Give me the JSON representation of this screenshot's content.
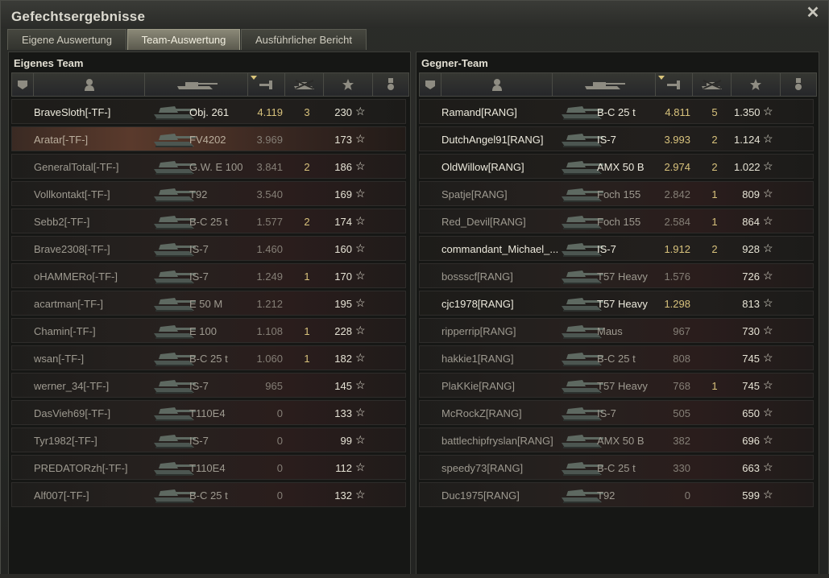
{
  "window": {
    "title": "Gefechtsergebnisse"
  },
  "tabs": [
    {
      "label": "Eigene Auswertung"
    },
    {
      "label": "Team-Auswertung"
    },
    {
      "label": "Ausführlicher Bericht"
    }
  ],
  "active_tab": 1,
  "left": {
    "title": "Eigenes Team",
    "rows": [
      {
        "name": "BraveSloth[-TF-]",
        "tank": "Obj. 261",
        "xp": "4.119",
        "kills": "3",
        "points": "230",
        "style": "hl",
        "xp_style": "gold"
      },
      {
        "name": "Aratar[-TF-]",
        "tank": "FV4202",
        "xp": "3.969",
        "kills": "",
        "points": "173",
        "style": "self",
        "xp_style": "gray"
      },
      {
        "name": "GeneralTotal[-TF-]",
        "tank": "G.W. E 100",
        "xp": "3.841",
        "kills": "2",
        "points": "186",
        "style": "dim",
        "xp_style": "gray"
      },
      {
        "name": "Vollkontakt[-TF-]",
        "tank": "T92",
        "xp": "3.540",
        "kills": "",
        "points": "169",
        "style": "dim",
        "xp_style": "gray"
      },
      {
        "name": "Sebb2[-TF-]",
        "tank": "B-C 25 t",
        "xp": "1.577",
        "kills": "2",
        "points": "174",
        "style": "dim",
        "xp_style": "gray"
      },
      {
        "name": "Brave2308[-TF-]",
        "tank": "IS-7",
        "xp": "1.460",
        "kills": "",
        "points": "160",
        "style": "dim",
        "xp_style": "gray"
      },
      {
        "name": "oHAMMERo[-TF-]",
        "tank": "IS-7",
        "xp": "1.249",
        "kills": "1",
        "points": "170",
        "style": "dim",
        "xp_style": "gray"
      },
      {
        "name": "acartman[-TF-]",
        "tank": "E 50 M",
        "xp": "1.212",
        "kills": "",
        "points": "195",
        "style": "dim",
        "xp_style": "gray"
      },
      {
        "name": "Chamin[-TF-]",
        "tank": "E 100",
        "xp": "1.108",
        "kills": "1",
        "points": "228",
        "style": "dim",
        "xp_style": "gray"
      },
      {
        "name": "wsan[-TF-]",
        "tank": "B-C 25 t",
        "xp": "1.060",
        "kills": "1",
        "points": "182",
        "style": "dim",
        "xp_style": "gray"
      },
      {
        "name": "werner_34[-TF-]",
        "tank": "IS-7",
        "xp": "965",
        "kills": "",
        "points": "145",
        "style": "dim",
        "xp_style": "gray"
      },
      {
        "name": "DasVieh69[-TF-]",
        "tank": "T110E4",
        "xp": "0",
        "kills": "",
        "points": "133",
        "style": "dim",
        "xp_style": "gray"
      },
      {
        "name": "Tyr1982[-TF-]",
        "tank": "IS-7",
        "xp": "0",
        "kills": "",
        "points": "99",
        "style": "dim",
        "xp_style": "gray"
      },
      {
        "name": "PREDATORzh[-TF-]",
        "tank": "T110E4",
        "xp": "0",
        "kills": "",
        "points": "112",
        "style": "dim",
        "xp_style": "gray"
      },
      {
        "name": "Alf007[-TF-]",
        "tank": "B-C 25 t",
        "xp": "0",
        "kills": "",
        "points": "132",
        "style": "dim",
        "xp_style": "gray"
      }
    ]
  },
  "right": {
    "title": "Gegner-Team",
    "rows": [
      {
        "name": "Ramand[RANG]",
        "tank": "B-C 25 t",
        "xp": "4.811",
        "kills": "5",
        "points": "1.350",
        "style": "hl",
        "xp_style": "gold"
      },
      {
        "name": "DutchAngel91[RANG]",
        "tank": "IS-7",
        "xp": "3.993",
        "kills": "2",
        "points": "1.124",
        "style": "hl",
        "xp_style": "gold"
      },
      {
        "name": "OldWillow[RANG]",
        "tank": "AMX 50 B",
        "xp": "2.974",
        "kills": "2",
        "points": "1.022",
        "style": "hl",
        "xp_style": "gold"
      },
      {
        "name": "Spatje[RANG]",
        "tank": "Foch 155",
        "xp": "2.842",
        "kills": "1",
        "points": "809",
        "style": "dim",
        "xp_style": "gray"
      },
      {
        "name": "Red_Devil[RANG]",
        "tank": "Foch 155",
        "xp": "2.584",
        "kills": "1",
        "points": "864",
        "style": "dim",
        "xp_style": "gray"
      },
      {
        "name": "commandant_Michael_...",
        "tank": "IS-7",
        "xp": "1.912",
        "kills": "2",
        "points": "928",
        "style": "hl",
        "xp_style": "gold"
      },
      {
        "name": "bossscf[RANG]",
        "tank": "T57 Heavy",
        "xp": "1.576",
        "kills": "",
        "points": "726",
        "style": "dim",
        "xp_style": "gray"
      },
      {
        "name": "cjc1978[RANG]",
        "tank": "T57 Heavy",
        "xp": "1.298",
        "kills": "",
        "points": "813",
        "style": "hl",
        "xp_style": "gold"
      },
      {
        "name": "ripperrip[RANG]",
        "tank": "Maus",
        "xp": "967",
        "kills": "",
        "points": "730",
        "style": "dim",
        "xp_style": "gray"
      },
      {
        "name": "hakkie1[RANG]",
        "tank": "B-C 25 t",
        "xp": "808",
        "kills": "",
        "points": "745",
        "style": "dim",
        "xp_style": "gray"
      },
      {
        "name": "PlaKKie[RANG]",
        "tank": "T57 Heavy",
        "xp": "768",
        "kills": "1",
        "points": "745",
        "style": "dim",
        "xp_style": "gray"
      },
      {
        "name": "McRockZ[RANG]",
        "tank": "IS-7",
        "xp": "505",
        "kills": "",
        "points": "650",
        "style": "dim",
        "xp_style": "gray"
      },
      {
        "name": "battlechipfryslan[RANG]",
        "tank": "AMX 50 B",
        "xp": "382",
        "kills": "",
        "points": "696",
        "style": "dim",
        "xp_style": "gray"
      },
      {
        "name": "speedy73[RANG]",
        "tank": "B-C 25 t",
        "xp": "330",
        "kills": "",
        "points": "663",
        "style": "dim",
        "xp_style": "gray"
      },
      {
        "name": "Duc1975[RANG]",
        "tank": "T92",
        "xp": "0",
        "kills": "",
        "points": "599",
        "style": "dim",
        "xp_style": "gray"
      }
    ]
  },
  "icons": {
    "close": "close-icon",
    "star": "star-icon",
    "columns": [
      "platoon-icon",
      "player-icon",
      "tank-icon",
      "damage-icon",
      "kills-icon",
      "points-icon",
      "medal-icon"
    ]
  },
  "colors": {
    "gold": "#d8c27c",
    "accent_tab": "#8a8877"
  }
}
